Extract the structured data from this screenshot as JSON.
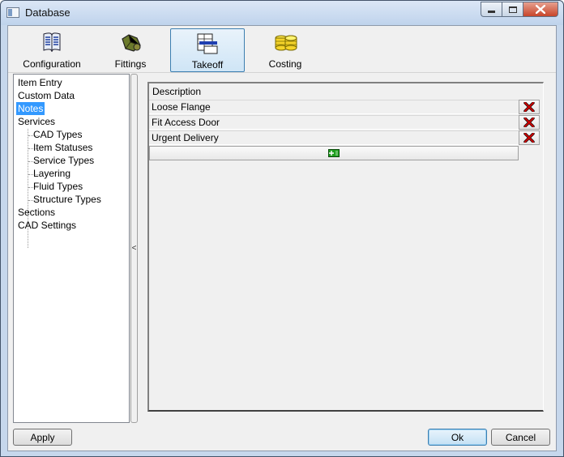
{
  "window": {
    "title": "Database",
    "icon": "database-window-icon"
  },
  "toolbar": {
    "buttons": [
      {
        "label": "Configuration",
        "icon": "configuration-book-icon"
      },
      {
        "label": "Fittings",
        "icon": "fittings-icon"
      },
      {
        "label": "Takeoff",
        "icon": "takeoff-icon",
        "active": true
      },
      {
        "label": "Costing",
        "icon": "costing-coins-icon"
      }
    ]
  },
  "tree": {
    "items": [
      {
        "label": "Item Entry",
        "level": 0
      },
      {
        "label": "Custom Data",
        "level": 0
      },
      {
        "label": "Notes",
        "level": 0,
        "selected": true
      },
      {
        "label": "Services",
        "level": 0
      },
      {
        "label": "CAD Types",
        "level": 1
      },
      {
        "label": "Item Statuses",
        "level": 1
      },
      {
        "label": "Service Types",
        "level": 1
      },
      {
        "label": "Layering",
        "level": 1
      },
      {
        "label": "Fluid Types",
        "level": 1
      },
      {
        "label": "Structure Types",
        "level": 1
      },
      {
        "label": "Sections",
        "level": 0
      },
      {
        "label": "CAD Settings",
        "level": 0
      }
    ]
  },
  "splitter": {
    "glyph": "<"
  },
  "grid": {
    "header": "Description",
    "rows": [
      "Loose Flange",
      "Fit Access Door",
      "Urgent Delivery"
    ]
  },
  "footer": {
    "apply_label": "Apply",
    "ok_label": "Ok",
    "cancel_label": "Cancel"
  },
  "colors": {
    "selection": "#3399ff",
    "delete_x": "#cc0000",
    "add_icon": "#1e9e1e",
    "active_tab_border": "#3c7fb1"
  }
}
